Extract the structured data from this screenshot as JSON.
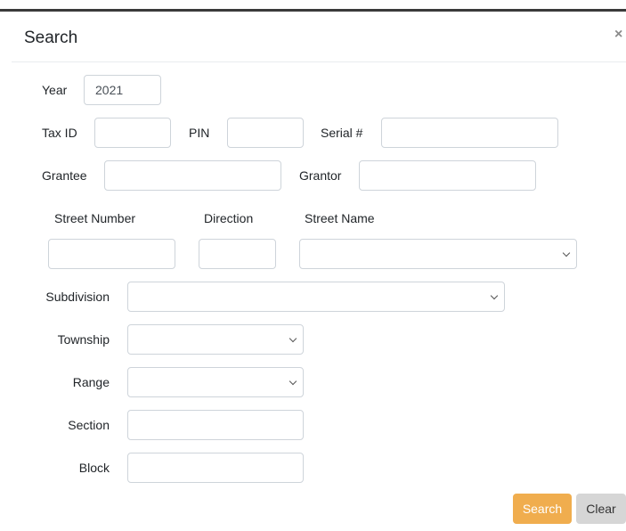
{
  "modal": {
    "title": "Search",
    "close_symbol": "×"
  },
  "fields": {
    "year": {
      "label": "Year",
      "value": "2021"
    },
    "tax_id": {
      "label": "Tax ID",
      "value": ""
    },
    "pin": {
      "label": "PIN",
      "value": ""
    },
    "serial": {
      "label": "Serial #",
      "value": ""
    },
    "grantee": {
      "label": "Grantee",
      "value": ""
    },
    "grantor": {
      "label": "Grantor",
      "value": ""
    },
    "street_number": {
      "label": "Street Number",
      "value": ""
    },
    "direction": {
      "label": "Direction",
      "value": ""
    },
    "street_name": {
      "label": "Street Name",
      "selected": ""
    },
    "subdivision": {
      "label": "Subdivision",
      "selected": ""
    },
    "township": {
      "label": "Township",
      "selected": ""
    },
    "range": {
      "label": "Range",
      "selected": ""
    },
    "section": {
      "label": "Section",
      "value": ""
    },
    "block": {
      "label": "Block",
      "value": ""
    }
  },
  "buttons": {
    "search": "Search",
    "clear": "Clear"
  },
  "colors": {
    "search_button": "#f0ad4e",
    "clear_button": "#d6d6d6",
    "border": "#ced4da"
  }
}
